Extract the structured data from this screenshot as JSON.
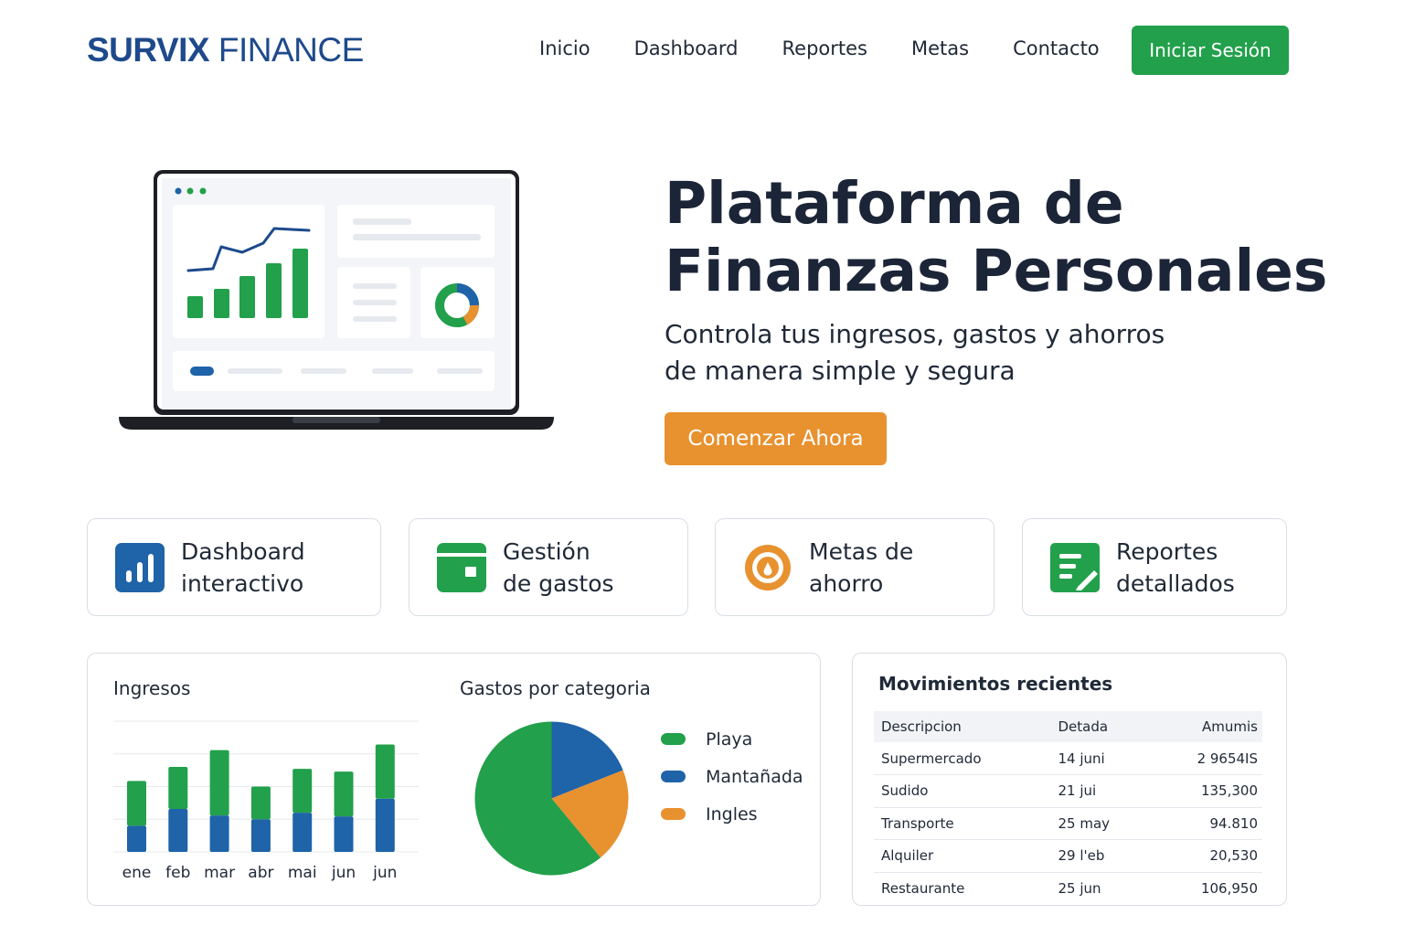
{
  "brand": {
    "name_strong": "SURVIX",
    "name_light": "FINANCE"
  },
  "nav": {
    "items": [
      "Inicio",
      "Dashboard",
      "Reportes",
      "Metas",
      "Contacto"
    ],
    "login_label": "Iniciar Sesión"
  },
  "hero": {
    "title_line1": "Plataforma de",
    "title_line2": "Finanzas Personales",
    "subtitle_line1": "Controla tus ingresos, gastos y ahorros",
    "subtitle_line2": "de manera simple y segura",
    "cta_label": "Comenzar Ahora"
  },
  "features": [
    {
      "line1": "Dashboard",
      "line2": "interactivo",
      "icon": "bar-chart-icon"
    },
    {
      "line1": "Gestión",
      "line2": "de gastos",
      "icon": "wallet-icon"
    },
    {
      "line1": "Metas de",
      "line2": "ahorro",
      "icon": "target-icon"
    },
    {
      "line1": "Reportes",
      "line2": "detallados",
      "icon": "report-icon"
    }
  ],
  "charts": {
    "ingresos_title": "Ingresos",
    "gastos_title": "Gastos por categoria"
  },
  "chart_data": [
    {
      "type": "bar",
      "stacked": true,
      "title": "Ingresos",
      "categories": [
        "ene",
        "feb",
        "mar",
        "abr",
        "mai",
        "jun",
        "jun"
      ],
      "series": [
        {
          "color": "#1f63a8",
          "values": [
            28,
            46,
            39,
            35,
            42,
            38,
            57
          ]
        },
        {
          "color": "#22a04b",
          "values": [
            48,
            45,
            70,
            35,
            47,
            48,
            58
          ]
        }
      ],
      "ylim": [
        0,
        140
      ],
      "grid": true
    },
    {
      "type": "pie",
      "title": "Gastos por categoria",
      "slices": [
        {
          "name": "Playa",
          "value": 61,
          "color": "#22a04b"
        },
        {
          "name": "Mantañada",
          "value": 19,
          "color": "#1f63a8"
        },
        {
          "name": "Ingles",
          "value": 20,
          "color": "#e8912f"
        }
      ],
      "legend": "right"
    }
  ],
  "movements": {
    "title": "Movimientos recientes",
    "headers": [
      "Descripcion",
      "Detada",
      "Amumis"
    ],
    "rows": [
      [
        "Supermercado",
        "14 juni",
        "2 9654IS"
      ],
      [
        "Sudido",
        "21 jui",
        "135,300"
      ],
      [
        "Transporte",
        "25 may",
        "94.810"
      ],
      [
        "Alquiler",
        "29 l'eb",
        "20,530"
      ],
      [
        "Restaurante",
        "25 jun",
        "106,950"
      ]
    ]
  },
  "colors": {
    "brand_blue": "#1e4a8c",
    "green": "#22a04b",
    "blue": "#1f63a8",
    "orange": "#e8912f"
  }
}
